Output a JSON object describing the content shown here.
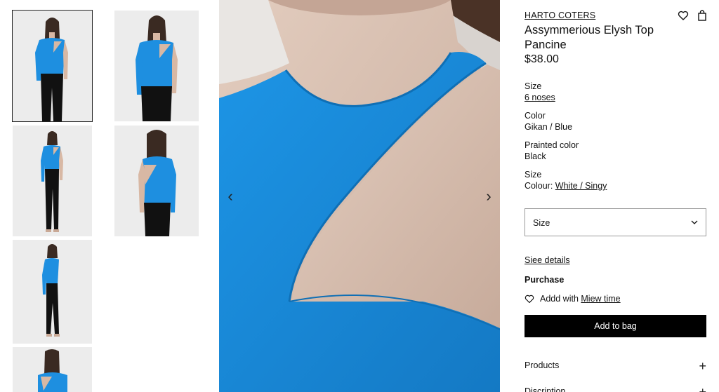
{
  "thumbnails": [
    {
      "view": "front-three-quarter",
      "active": true
    },
    {
      "view": "front-closeup",
      "active": false
    },
    {
      "view": "full-length-front",
      "active": false
    },
    {
      "view": "back",
      "active": false
    },
    {
      "view": "side-full-length",
      "active": false
    },
    {
      "view": "back-closeup",
      "active": false
    }
  ],
  "gallery": {
    "prev_icon": "‹",
    "next_icon": "›"
  },
  "product": {
    "brand": "HARTO COTERS",
    "title": "Assymmerious Elysh Top Pancine",
    "price": "$38.00",
    "attributes": [
      {
        "label": "Size",
        "value": "6 noses",
        "underline": true
      },
      {
        "label": "Color",
        "value": "Gikan / Blue",
        "underline": false
      },
      {
        "label": "Prainted color",
        "value": "Black",
        "underline": false
      },
      {
        "label": "Size",
        "value_prefix": "Colour: ",
        "value": "White / Singy",
        "underline": true
      }
    ]
  },
  "size_select": {
    "label": "Size"
  },
  "see_details": "Siee details",
  "purchase": {
    "heading": "Purchase",
    "add_with_prefix": "Addd with ",
    "add_with_link": "Miew time"
  },
  "add_to_bag": "Add to bag",
  "accordions": [
    {
      "label": "Products"
    },
    {
      "label": "Discription"
    }
  ],
  "colors": {
    "top_blue": "#1e8fe0",
    "button_black": "#000000",
    "backdrop": "#ececec"
  },
  "icons": [
    "heart-icon",
    "bag-icon",
    "chevron-left-icon",
    "chevron-right-icon",
    "chevron-down-icon",
    "heart-outline-icon",
    "plus-icon"
  ]
}
